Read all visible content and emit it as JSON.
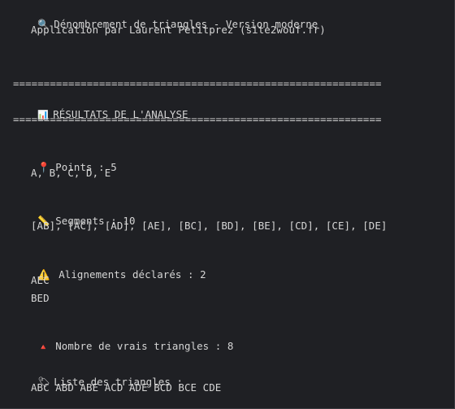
{
  "header": {
    "title": "Dénombrement de triangles - Version moderne",
    "subtitle": "Application par Laurent Petitprez (site2wouf.fr)"
  },
  "separator": "============================================================",
  "results": {
    "heading": "RÉSULTATS DE L'ANALYSE"
  },
  "points": {
    "label": "Points : 5",
    "values": "A, B, C, D, E"
  },
  "segments": {
    "label": "Segments : 10",
    "values": "[AB], [AC], [AD], [AE], [BC], [BD], [BE], [CD], [CE], [DE]"
  },
  "alignments": {
    "label": "Alignements déclarés : 2",
    "items": [
      "AEC",
      "BED"
    ]
  },
  "triangles": {
    "count_label": "Nombre de vrais triangles : 8",
    "list_label": "Liste des triangles :",
    "list": "ABC ABD ABE ACD ADE BCD BCE CDE"
  },
  "icons": {
    "title": "magnifier-icon",
    "results": "bar-chart-icon",
    "points": "round-pushpin-icon",
    "segments": "ruler-icon",
    "alignments": "warning-icon",
    "triangles": "red-triangle-icon",
    "list": "label-tag-icon"
  }
}
